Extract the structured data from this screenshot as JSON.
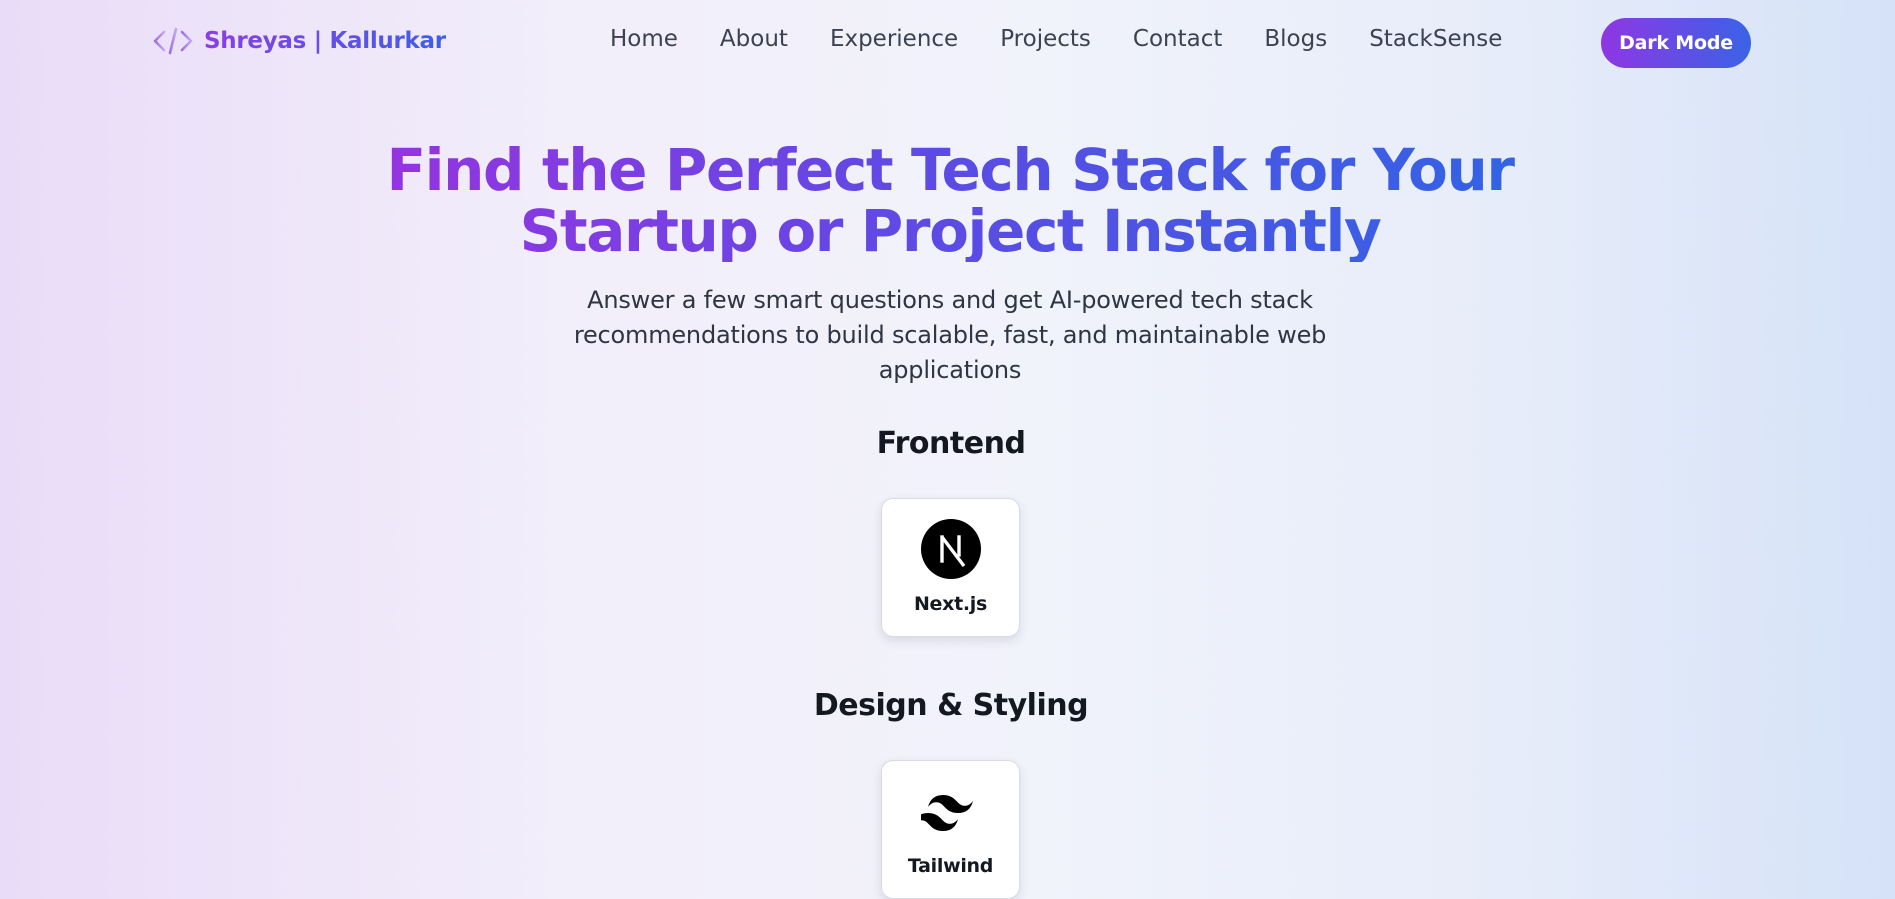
{
  "brand": {
    "name": "Shreyas | Kallurkar",
    "icon": "code-brackets-icon"
  },
  "nav": {
    "items": [
      {
        "label": "Home"
      },
      {
        "label": "About"
      },
      {
        "label": "Experience"
      },
      {
        "label": "Projects"
      },
      {
        "label": "Contact"
      },
      {
        "label": "Blogs"
      },
      {
        "label": "StackSense"
      }
    ],
    "dark_mode_label": "Dark Mode"
  },
  "hero": {
    "title_line1": "Find the Perfect Tech Stack for Your",
    "title_line2": "Startup or Project Instantly",
    "subtitle": "Answer a few smart questions and get AI-powered tech stack recommendations to build scalable, fast, and maintainable web applications"
  },
  "sections": [
    {
      "title": "Frontend",
      "items": [
        {
          "label": "Next.js",
          "icon": "nextjs-logo-icon"
        }
      ]
    },
    {
      "title": "Design & Styling",
      "items": [
        {
          "label": "Tailwind",
          "icon": "tailwind-logo-icon"
        }
      ]
    }
  ],
  "colors": {
    "accent_start": "#8f36e3",
    "accent_end": "#3a63e6",
    "text_dark": "#141821"
  }
}
